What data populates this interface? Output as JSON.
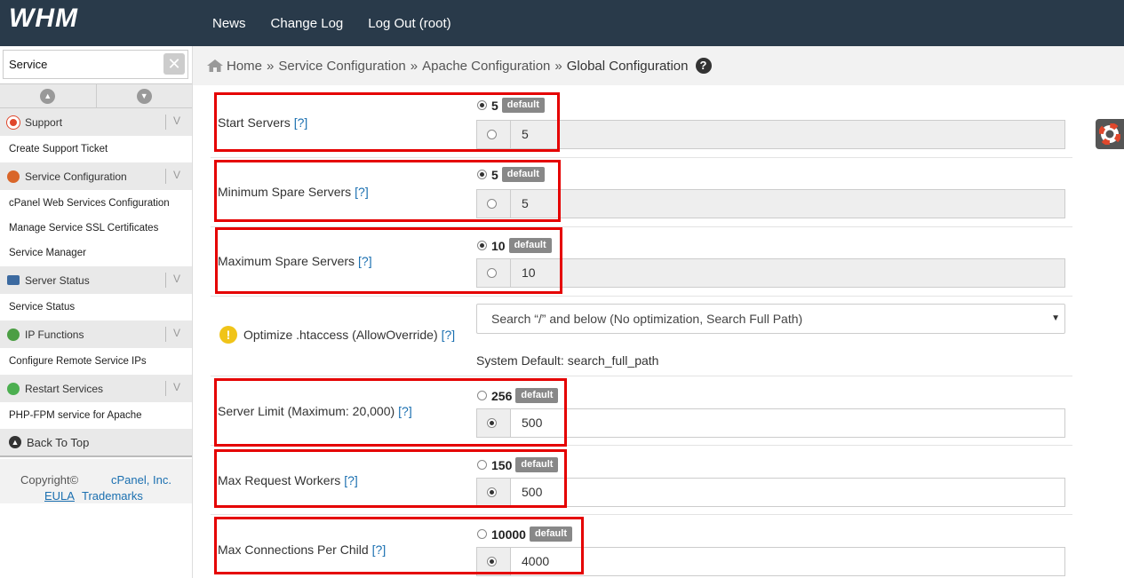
{
  "header": {
    "logo": "WHM",
    "nav": [
      "News",
      "Change Log",
      "Log Out (root)"
    ]
  },
  "sidebar": {
    "search_value": "Service",
    "sections": [
      {
        "title": "Support",
        "links": [
          "Create Support Ticket"
        ]
      },
      {
        "title": "Service Configuration",
        "links": [
          "cPanel Web Services Configuration",
          "Manage Service SSL Certificates",
          "Service Manager"
        ]
      },
      {
        "title": "Server Status",
        "links": [
          "Service Status"
        ]
      },
      {
        "title": "IP Functions",
        "links": [
          "Configure Remote Service IPs"
        ]
      },
      {
        "title": "Restart Services",
        "links": [
          "PHP-FPM service for Apache"
        ]
      }
    ],
    "back_to_top": "Back To Top",
    "footer": {
      "copyright": "Copyright©",
      "company": "cPanel, Inc.",
      "eula": "EULA",
      "trademarks": "Trademarks"
    }
  },
  "breadcrumb": {
    "items": [
      "Home",
      "Service Configuration",
      "Apache Configuration"
    ],
    "current": "Global Configuration",
    "separator": "»"
  },
  "settings": {
    "help": "[?]",
    "default_badge": "default",
    "start_servers": {
      "label": "Start Servers",
      "default": "5",
      "value": "5"
    },
    "min_spare": {
      "label": "Minimum Spare Servers",
      "default": "5",
      "value": "5"
    },
    "max_spare": {
      "label": "Maximum Spare Servers",
      "default": "10",
      "value": "10"
    },
    "htaccess": {
      "label": "Optimize .htaccess (AllowOverride)",
      "selected": "Search “/” and below (No optimization, Search Full Path)",
      "system_default": "System Default: search_full_path"
    },
    "server_limit": {
      "label": "Server Limit (Maximum: 20,000)",
      "default": "256",
      "value": "500"
    },
    "max_workers": {
      "label": "Max Request Workers",
      "default": "150",
      "value": "500"
    },
    "max_conn": {
      "label": "Max Connections Per Child",
      "default": "10000",
      "value": "4000"
    }
  },
  "colors": {
    "topbar": "#293a4a",
    "highlight": "#e50000",
    "link": "#1a6fb0"
  }
}
